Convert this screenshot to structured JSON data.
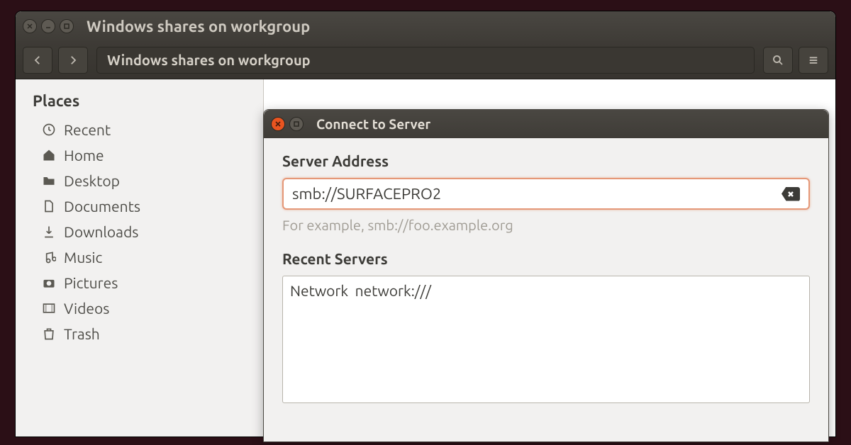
{
  "window": {
    "title": "Windows shares on workgroup",
    "breadcrumb": "Windows shares on workgroup"
  },
  "sidebar": {
    "heading": "Places",
    "items": [
      {
        "label": "Recent",
        "icon": "clock"
      },
      {
        "label": "Home",
        "icon": "home"
      },
      {
        "label": "Desktop",
        "icon": "desktop"
      },
      {
        "label": "Documents",
        "icon": "document"
      },
      {
        "label": "Downloads",
        "icon": "download"
      },
      {
        "label": "Music",
        "icon": "music"
      },
      {
        "label": "Pictures",
        "icon": "camera"
      },
      {
        "label": "Videos",
        "icon": "video"
      },
      {
        "label": "Trash",
        "icon": "trash"
      }
    ]
  },
  "dialog": {
    "title": "Connect to Server",
    "server_label": "Server Address",
    "server_value": "smb://SURFACEPRO2",
    "hint": "For example, smb://foo.example.org",
    "recent_label": "Recent Servers",
    "recent_items": [
      "Network  network:///"
    ]
  }
}
